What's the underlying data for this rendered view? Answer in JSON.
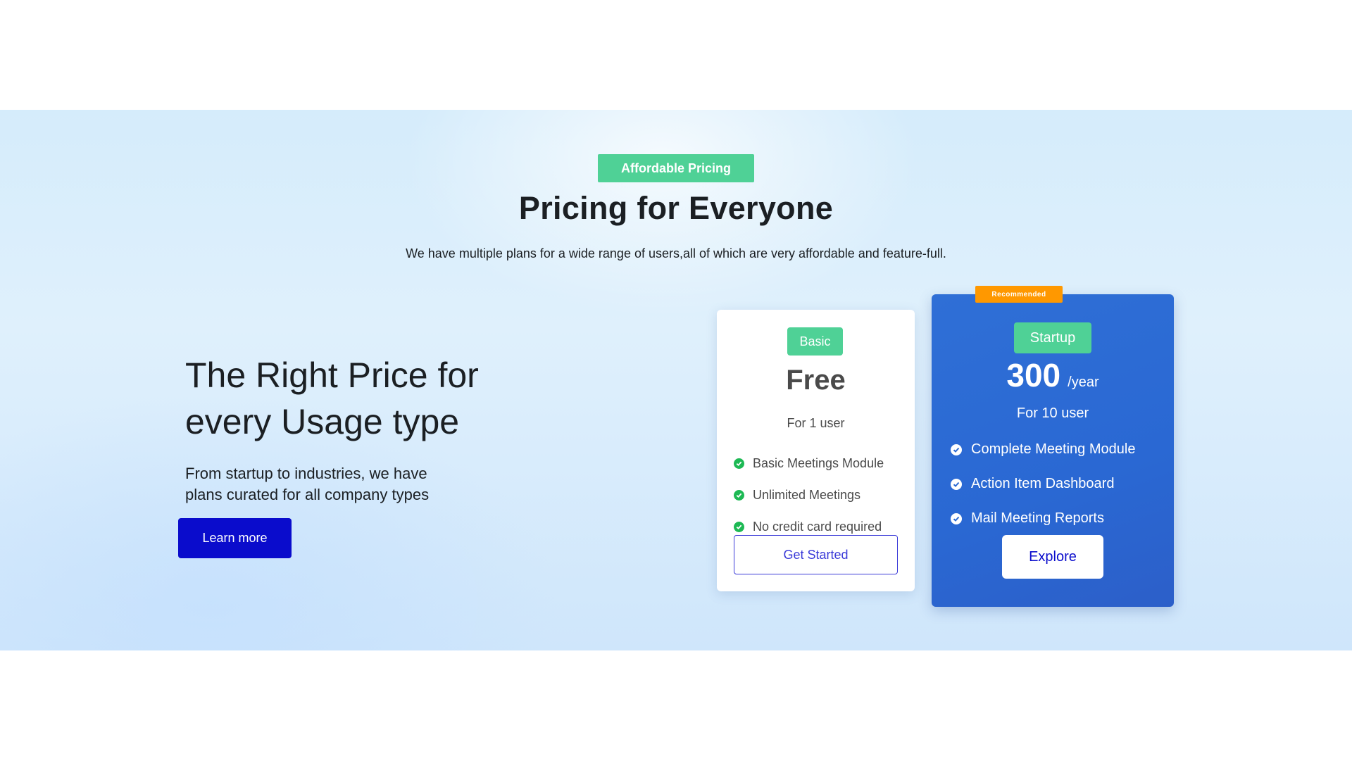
{
  "header": {
    "badge": "Affordable Pricing",
    "title": "Pricing for Everyone",
    "subtitle": "We have multiple plans for a wide range of users,all of which are very affordable and feature-full."
  },
  "intro": {
    "heading_line1": "The Right Price for",
    "heading_line2": "every Usage type",
    "paragraph_line1": "From startup to industries, we have",
    "paragraph_line2": "plans curated for all company types",
    "cta": "Learn more"
  },
  "plans": [
    {
      "name": "Basic",
      "price": "Free",
      "users": "For 1 user",
      "features": [
        "Basic Meetings Module",
        "Unlimited Meetings",
        "No credit card required"
      ],
      "cta": "Get Started"
    },
    {
      "badge": "Recommended",
      "name": "Startup",
      "price": "300",
      "period": "/year",
      "users": "For 10 user",
      "features": [
        "Complete Meeting Module",
        "Action Item Dashboard",
        "Mail Meeting Reports"
      ],
      "cta": "Explore"
    }
  ],
  "colors": {
    "accent_green": "#4fd196",
    "primary_blue": "#0a0ccc",
    "card_blue": "#2f6fd6",
    "recommended_orange": "#ff9800",
    "check_green": "#1db954"
  },
  "icons": {
    "feature_check": "check-circle-icon"
  }
}
